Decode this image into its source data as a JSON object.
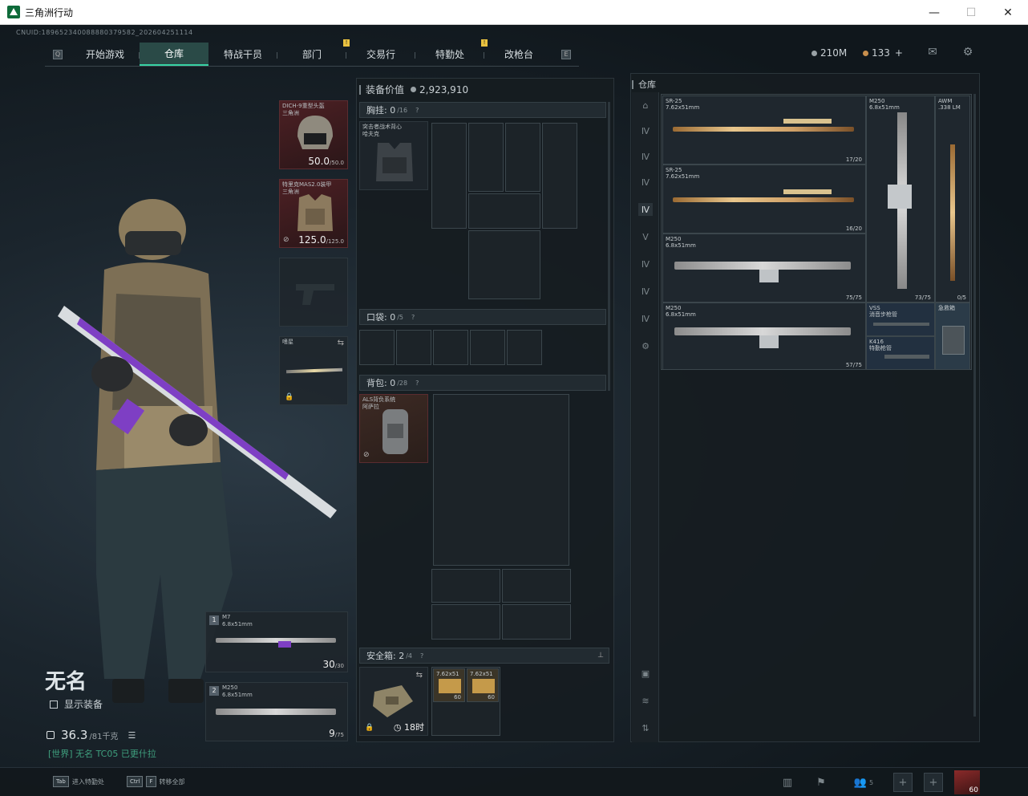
{
  "window": {
    "title": "三角洲行动",
    "minimize": "—",
    "maximize": "☐",
    "close": "✕"
  },
  "uid": "CNUID:189652340088880379582_202604251114",
  "nav": {
    "tabs": [
      {
        "label": "开始游戏",
        "active": false,
        "badge": false
      },
      {
        "label": "仓库",
        "active": true,
        "badge": false
      },
      {
        "label": "特战干员",
        "active": false,
        "badge": false
      },
      {
        "label": "部门",
        "active": false,
        "badge": true
      },
      {
        "label": "交易行",
        "active": false,
        "badge": false
      },
      {
        "label": "特勤处",
        "active": false,
        "badge": true
      },
      {
        "label": "改枪台",
        "active": false,
        "badge": false
      }
    ],
    "badge_mark": "!"
  },
  "currency": {
    "coins": "210M",
    "premium": "133",
    "add": "+"
  },
  "icons": {
    "mail": "mail-icon",
    "settings": "gear-icon"
  },
  "player": {
    "name": "无名",
    "show_equipment": "显示装备",
    "weight": "36.3",
    "weight_max": "/81千克",
    "info": "[世界] 无名 TC05 已更什拉"
  },
  "gear_slots": {
    "helmet": {
      "name": "DICH-9重型头盔",
      "sub": "三角洲",
      "durability": "50.0",
      "durability_max": "/50.0"
    },
    "armor": {
      "name": "特里克MAS2.0装甲",
      "sub": "三角洲",
      "durability": "125.0",
      "durability_max": "/125.0"
    },
    "melee": {
      "name": "嗜星"
    },
    "primary": {
      "index": "1",
      "name": "M7",
      "caliber": "6.8x51mm",
      "ammo": "30",
      "ammo_max": "/30"
    },
    "secondary": {
      "index": "2",
      "name": "M250",
      "caliber": "6.8x51mm",
      "ammo": "9",
      "ammo_max": "/75"
    }
  },
  "loadout": {
    "equipment_value_label": "装备价值",
    "equipment_value": "2,923,910",
    "chest_rig": {
      "label": "胸挂:",
      "count": "0",
      "max": "/16",
      "item": "突击者战术背心",
      "item_sub": "哈夫克"
    },
    "pocket": {
      "label": "口袋:",
      "count": "0",
      "max": "/5"
    },
    "backpack": {
      "label": "背包:",
      "count": "0",
      "max": "/28",
      "item": "ALS背负系统",
      "item_sub": "阿萨拉"
    },
    "safe_box": {
      "label": "安全箱:",
      "count": "2",
      "max": "/4",
      "timer": "18时",
      "items": [
        {
          "name": "7.62x51",
          "count": "60"
        },
        {
          "name": "7.62x51",
          "count": "60"
        }
      ]
    }
  },
  "stash": {
    "title": "仓库",
    "items": [
      {
        "name": "SR-25",
        "caliber": "7.62x51mm",
        "count": "17/20"
      },
      {
        "name": "SR-25",
        "caliber": "7.62x51mm",
        "count": "16/20"
      },
      {
        "name": "M250",
        "caliber": "6.8x51mm",
        "count": "75/75"
      },
      {
        "name": "M250",
        "caliber": "6.8x51mm",
        "count": "57/75"
      },
      {
        "name": "M250",
        "caliber": "6.8x51mm",
        "count": "73/75"
      },
      {
        "name": "AWM",
        "caliber": ".338 LM",
        "count": "0/5"
      },
      {
        "name": "VSS",
        "caliber": "消音步枪管",
        "count": ""
      },
      {
        "name": "K416",
        "caliber": "特勤枪管",
        "count": ""
      },
      {
        "name": "急救箱",
        "caliber": "",
        "count": ""
      }
    ]
  },
  "bottom": {
    "hint1_key": "Tab",
    "hint1": "进入特勤处",
    "hint2_key1": "Ctrl",
    "hint2_key2": "F",
    "hint2": "转移全部",
    "squad_count": "5",
    "level": "60"
  }
}
